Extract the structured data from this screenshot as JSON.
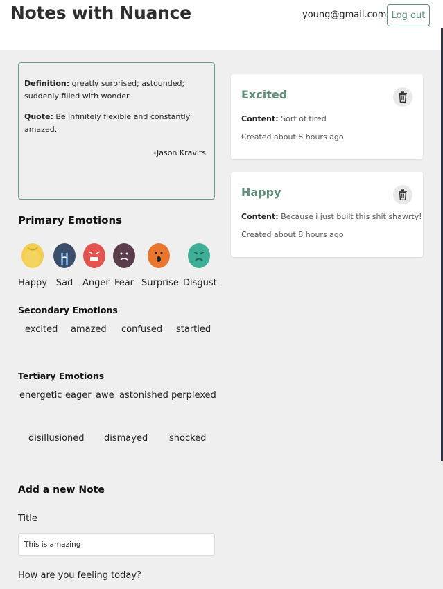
{
  "header": {
    "app_title": "Notes with Nuance",
    "user_email": "young@gmail.com",
    "logout_label": "Log out"
  },
  "definition": {
    "definition_label": "Definition:",
    "definition_text": "greatly surprised; astounded; suddenly filled with wonder.",
    "quote_label": "Quote:",
    "quote_text": "Be infinitely flexible and constantly amazed.",
    "author": "-Jason Kravits"
  },
  "primary": {
    "title": "Primary Emotions",
    "emotions": [
      {
        "label": "Happy",
        "icon": "happy-face-icon",
        "color": "#f2cf4f"
      },
      {
        "label": "Sad",
        "icon": "sad-face-icon",
        "color": "#3b4f6b"
      },
      {
        "label": "Anger",
        "icon": "angry-face-icon",
        "color": "#e2534f"
      },
      {
        "label": "Fear",
        "icon": "fear-face-icon",
        "color": "#5a3c4b"
      },
      {
        "label": "Surprise",
        "icon": "surprise-face-icon",
        "color": "#e8762f"
      },
      {
        "label": "Disgust",
        "icon": "disgust-face-icon",
        "color": "#3fae96"
      }
    ]
  },
  "secondary": {
    "title": "Secondary Emotions",
    "words": [
      "excited",
      "amazed",
      "confused",
      "startled"
    ]
  },
  "tertiary": {
    "title": "Tertiary Emotions",
    "words_row1": [
      "energetic",
      "eager",
      "awe",
      "astonished",
      "perplexed"
    ],
    "words_row2": [
      "disillusioned",
      "dismayed",
      "shocked"
    ]
  },
  "new_note": {
    "title": "Add a new Note",
    "title_label": "Title",
    "title_value": "This is amazing!",
    "feeling_label": "How are you feeling today?"
  },
  "notes": [
    {
      "title": "Excited",
      "content_label": "Content:",
      "content": "Sort of tired",
      "created": "Created about 8 hours ago"
    },
    {
      "title": "Happy",
      "content_label": "Content:",
      "content": "Because i just built this shit shawrty!",
      "created": "Created about 8 hours ago"
    }
  ],
  "colors": {
    "accent": "#5f8f7a",
    "background": "#efefef"
  }
}
